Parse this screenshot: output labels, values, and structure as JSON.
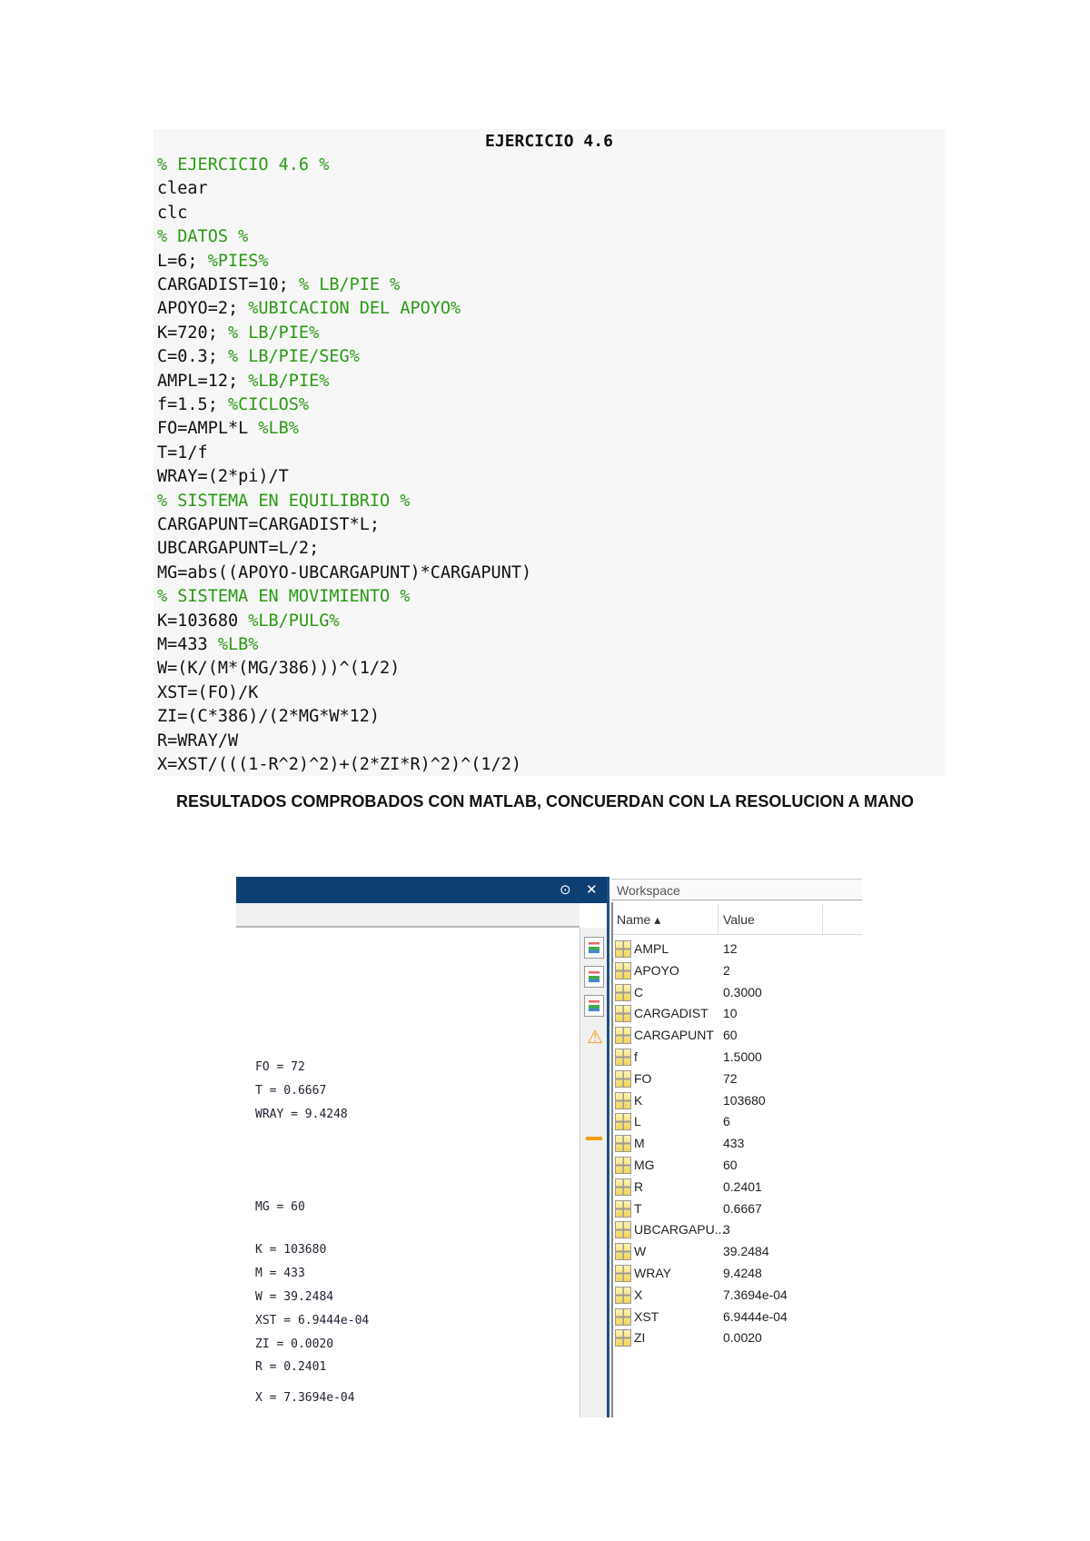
{
  "title": "EJERCICIO 4.6",
  "code_lines": [
    [
      [
        "",
        "cm"
      ],
      [
        "% EJERCICIO 4.6 %",
        "cm"
      ]
    ],
    [
      [
        "clear",
        ""
      ]
    ],
    [
      [
        "clc",
        ""
      ]
    ],
    [
      [
        "% DATOS %",
        "cm"
      ]
    ],
    [
      [
        "L=6; ",
        ""
      ],
      [
        "%PIES%",
        "cm"
      ]
    ],
    [
      [
        "CARGADIST=10; ",
        ""
      ],
      [
        "% LB/PIE %",
        "cm"
      ]
    ],
    [
      [
        "APOYO=2; ",
        ""
      ],
      [
        "%UBICACION DEL APOYO%",
        "cm"
      ]
    ],
    [
      [
        "K=720; ",
        ""
      ],
      [
        "% LB/PIE%",
        "cm"
      ]
    ],
    [
      [
        "C=0.3; ",
        ""
      ],
      [
        "% LB/PIE/SEG%",
        "cm"
      ]
    ],
    [
      [
        "AMPL=12; ",
        ""
      ],
      [
        "%LB/PIE%",
        "cm"
      ]
    ],
    [
      [
        "f=1.5; ",
        ""
      ],
      [
        "%CICLOS%",
        "cm"
      ]
    ],
    [
      [
        "FO=AMPL*L ",
        ""
      ],
      [
        "%LB%",
        "cm"
      ]
    ],
    [
      [
        "T=1/f",
        ""
      ]
    ],
    [
      [
        "WRAY=(2*pi)/T",
        ""
      ]
    ],
    [
      [
        "% SISTEMA EN EQUILIBRIO %",
        "cm"
      ]
    ],
    [
      [
        "CARGAPUNT=CARGADIST*L;",
        ""
      ]
    ],
    [
      [
        "UBCARGAPUNT=L/2;",
        ""
      ]
    ],
    [
      [
        "MG=abs((APOYO-UBCARGAPUNT)*CARGAPUNT)",
        ""
      ]
    ],
    [
      [
        "% SISTEMA EN MOVIMIENTO %",
        "cm"
      ]
    ],
    [
      [
        "K=103680 ",
        ""
      ],
      [
        "%LB/PULG%",
        "cm"
      ]
    ],
    [
      [
        "M=433 ",
        ""
      ],
      [
        "%LB%",
        "cm"
      ]
    ],
    [
      [
        "W=(K/(M*(MG/386)))^(1/2)",
        ""
      ]
    ],
    [
      [
        "XST=(FO)/K",
        ""
      ]
    ],
    [
      [
        "ZI=(C*386)/(2*MG*W*12)",
        ""
      ]
    ],
    [
      [
        "R=WRAY/W",
        ""
      ]
    ],
    [
      [
        "X=XST/(((1-R^2)^2)+(2*ZI*R)^2)^(1/2)",
        ""
      ]
    ]
  ],
  "results_heading": "RESULTADOS COMPROBADOS CON MATLAB, CONCUERDAN CON LA RESOLUCION A MANO",
  "console": {
    "outputs": [
      "FO = 72",
      "T = 0.6667",
      "WRAY = 9.4248",
      "MG = 60",
      "K = 103680",
      "M = 433",
      "W = 39.2484",
      "XST = 6.9444e-04",
      "ZI = 0.0020",
      "R = 0.2401",
      "X = 7.3694e-04"
    ]
  },
  "workspace": {
    "title": "Workspace",
    "col_name": "Name ▴",
    "col_value": "Value",
    "rows": [
      [
        "AMPL",
        "12"
      ],
      [
        "APOYO",
        "2"
      ],
      [
        "C",
        "0.3000"
      ],
      [
        "CARGADIST",
        "10"
      ],
      [
        "CARGAPUNT",
        "60"
      ],
      [
        "f",
        "1.5000"
      ],
      [
        "FO",
        "72"
      ],
      [
        "K",
        "103680"
      ],
      [
        "L",
        "6"
      ],
      [
        "M",
        "433"
      ],
      [
        "MG",
        "60"
      ],
      [
        "R",
        "0.2401"
      ],
      [
        "T",
        "0.6667"
      ],
      [
        "UBCARGAPU...",
        "3"
      ],
      [
        "W",
        "39.2484"
      ],
      [
        "WRAY",
        "9.4248"
      ],
      [
        "X",
        "7.3694e-04"
      ],
      [
        "XST",
        "6.9444e-04"
      ],
      [
        "ZI",
        "0.0020"
      ]
    ]
  },
  "colors": {
    "header": "#0e3f73",
    "comment": "#2a9a14",
    "warning": "#f39c12"
  }
}
